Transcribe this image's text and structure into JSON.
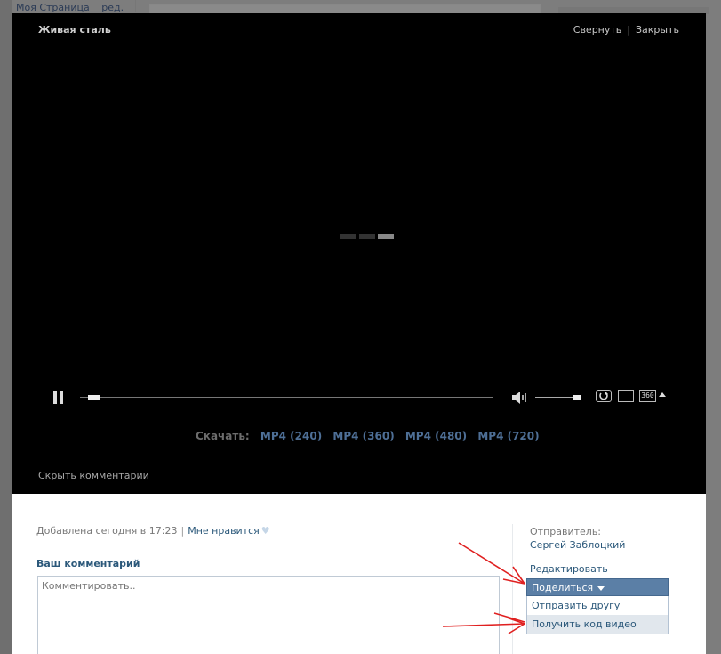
{
  "background": {
    "nav_items": [
      "Моя Страница",
      "ред."
    ]
  },
  "video": {
    "title": "Живая сталь",
    "minimize_label": "Свернуть",
    "close_label": "Закрыть",
    "quality_label": "360",
    "progress_fraction": 0.02,
    "volume_fraction": 1.0
  },
  "download": {
    "label": "Скачать:",
    "links": [
      "MP4 (240)",
      "MP4 (360)",
      "MP4 (480)",
      "MP4 (720)"
    ]
  },
  "hide_comments": "Скрыть комментарии",
  "info": {
    "added_text": "Добавлена сегодня в 17:23",
    "dislike_label": "Мне нравится",
    "comment_title": "Ваш комментарий",
    "comment_placeholder": "Комментировать..",
    "sender_label": "Отправитель:",
    "sender_name": "Сергей Заблоцкий",
    "edit_label": "Редактировать",
    "share_label": "Поделиться",
    "share_menu": [
      "Отправить другу",
      "Получить код видео"
    ]
  },
  "colors": {
    "link": "#2b587a",
    "accent": "#5b7fa6",
    "annotation": "#e02020"
  }
}
